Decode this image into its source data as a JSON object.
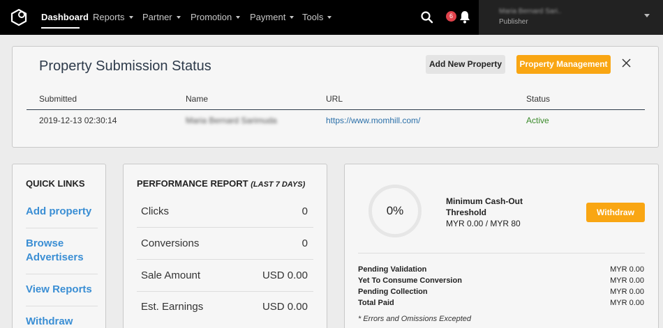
{
  "nav": {
    "items": [
      {
        "label": "Dashboard",
        "active": true
      },
      {
        "label": "Reports"
      },
      {
        "label": "Partner"
      },
      {
        "label": "Promotion"
      },
      {
        "label": "Payment"
      },
      {
        "label": "Tools"
      }
    ],
    "notification_count": "6",
    "user": {
      "name": "Maria Bernard Sari..",
      "role": "Publisher"
    }
  },
  "status_panel": {
    "title": "Property Submission Status",
    "add_button": "Add New Property",
    "manage_button": "Property Management",
    "columns": [
      "Submitted",
      "Name",
      "URL",
      "Status"
    ],
    "row": {
      "submitted": "2019-12-13 02:30:14",
      "name": "Maria Bernard Sarimuda",
      "url": "https://www.momhill.com/",
      "status": "Active"
    }
  },
  "quick_links": {
    "title": "QUICK LINKS",
    "links": [
      "Add property",
      "Browse Advertisers",
      "View Reports",
      "Withdraw"
    ]
  },
  "performance": {
    "title": "PERFORMANCE REPORT",
    "period": "(LAST 7 DAYS)",
    "rows": [
      {
        "label": "Clicks",
        "value": "0"
      },
      {
        "label": "Conversions",
        "value": "0"
      },
      {
        "label": "Sale Amount",
        "value": "USD 0.00"
      },
      {
        "label": "Est. Earnings",
        "value": "USD 0.00"
      }
    ]
  },
  "cashout": {
    "progress_label": "0%",
    "progress_fraction": 0,
    "threshold_title": "Minimum Cash-Out Threshold",
    "threshold_amount": "MYR 0.00 / MYR 80",
    "withdraw_button": "Withdraw",
    "balances": [
      {
        "label": "Pending Validation",
        "value": "MYR 0.00"
      },
      {
        "label": "Yet To Consume Conversion",
        "value": "MYR 0.00"
      },
      {
        "label": "Pending Collection",
        "value": "MYR 0.00"
      },
      {
        "label": "Total Paid",
        "value": "MYR 0.00"
      }
    ],
    "disclaimer": "* Errors and Omissions Excepted"
  },
  "colors": {
    "accent": "#f9a613",
    "link": "#3a8ed4",
    "active_status": "#3a8a2a",
    "badge": "#e0424b"
  }
}
